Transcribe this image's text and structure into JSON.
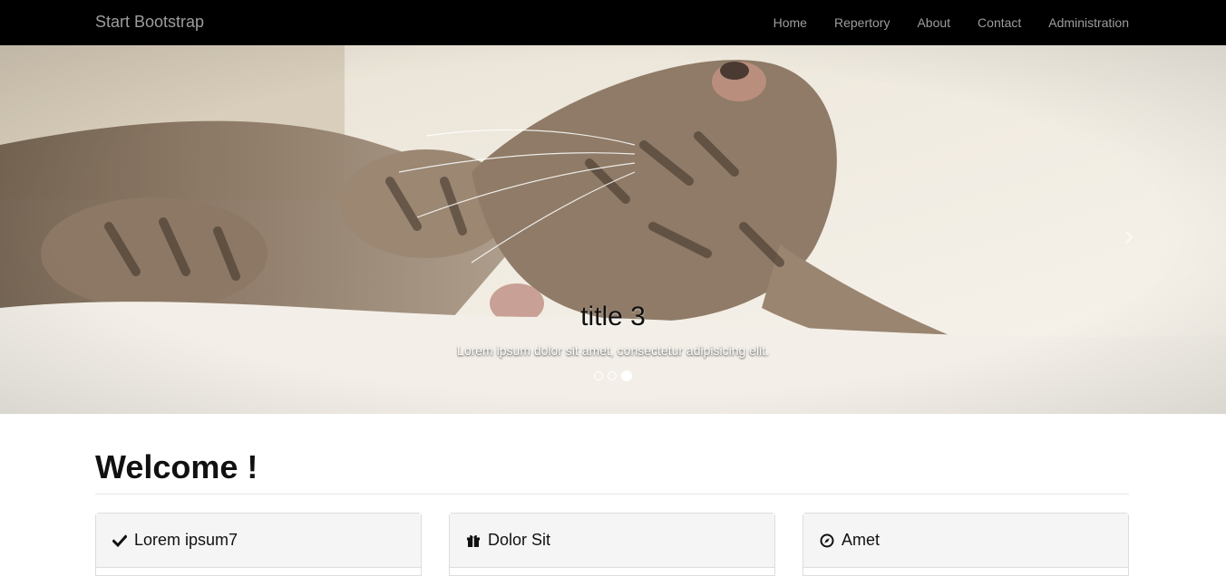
{
  "navbar": {
    "brand": "Start Bootstrap",
    "links": [
      "Home",
      "Repertory",
      "About",
      "Contact",
      "Administration"
    ]
  },
  "carousel": {
    "title": "title 3",
    "text": "Lorem ipsum dolor sit amet, consectetur adipisicing elit.",
    "active_index": 2,
    "slide_count": 3
  },
  "content": {
    "heading": "Welcome !",
    "panels": [
      {
        "icon": "check-icon",
        "title": "Lorem ipsum7"
      },
      {
        "icon": "gift-icon",
        "title": "Dolor Sit"
      },
      {
        "icon": "compass-icon",
        "title": "Amet"
      }
    ]
  }
}
